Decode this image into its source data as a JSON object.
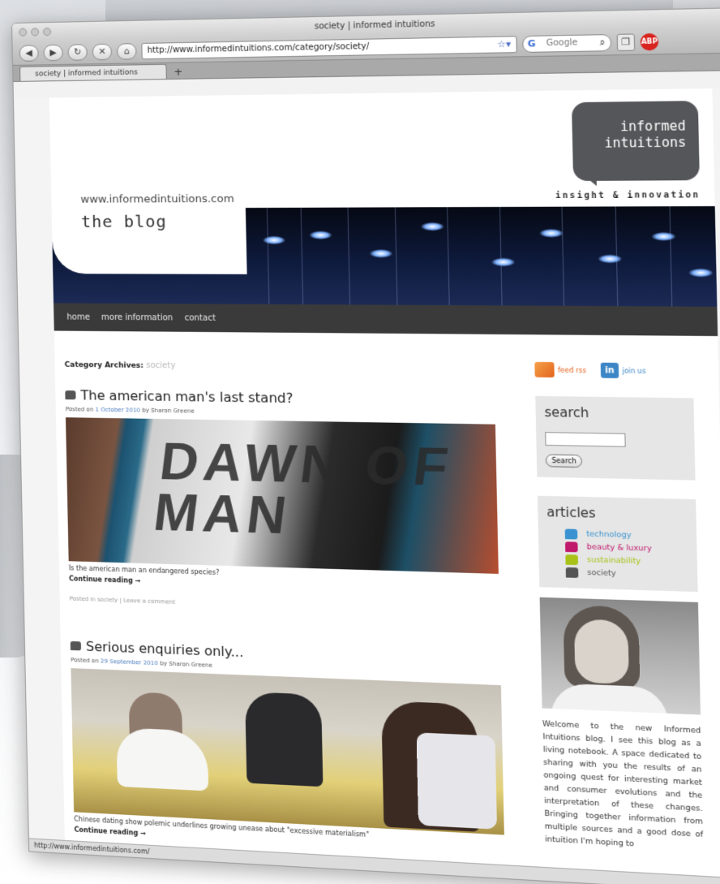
{
  "browser": {
    "window_title": "society | informed intuitions",
    "url": "http://www.informedintuitions.com/category/society/",
    "search_placeholder": "Google",
    "tab_title": "society | informed intuitions",
    "new_tab_symbol": "+",
    "status_url": "http://www.informedintuitions.com/"
  },
  "header": {
    "site_url": "www.informedintuitions.com",
    "blog_title": "the blog",
    "logo_line1": "informed",
    "logo_line2": "intuitions",
    "tagline": "insight & innovation"
  },
  "nav": {
    "items": [
      "home",
      "more information",
      "contact"
    ]
  },
  "content": {
    "category_label": "Category Archives:",
    "category_name": "society",
    "posts": [
      {
        "title": "The american man's last stand?",
        "posted_on": "Posted on",
        "date": "1 October 2010",
        "by": "by Sharon Greene",
        "image_text": "DAWN OF MAN",
        "excerpt": "Is the american man an endangered species?",
        "continue": "Continue reading →",
        "footer": "Posted in society | Leave a comment"
      },
      {
        "title": "Serious enquiries only...",
        "posted_on": "Posted on",
        "date": "29 September 2010",
        "by": "by Sharon Greene",
        "excerpt": "Chinese dating show polemic underlines growing unease about \"excessive materialism\"",
        "continue": "Continue reading →"
      }
    ]
  },
  "sidebar": {
    "feed_label": "feed rss",
    "join_label": "join us",
    "li_glyph": "in",
    "search_heading": "search",
    "search_button": "Search",
    "articles_heading": "articles",
    "articles": [
      {
        "label": "technology",
        "color": "#3a93d0"
      },
      {
        "label": "beauty & luxury",
        "color": "#c0186b"
      },
      {
        "label": "sustainability",
        "color": "#a8c21a"
      },
      {
        "label": "society",
        "color": "#555555"
      }
    ],
    "intro": "Welcome to the new Informed Intuitions blog. I see this blog as a living notebook. A space dedicated to sharing with you the results of an ongoing quest for interesting market and consumer evolutions and the interpretation of these changes. Bringing together information from multiple sources and a good dose of intuition I'm hoping to"
  },
  "icons": {
    "back": "back-icon",
    "forward": "forward-icon",
    "reload": "reload-icon",
    "stop": "stop-icon",
    "home": "home-icon",
    "rss": "rss-icon",
    "linkedin": "linkedin-icon",
    "adblock": "adblock-icon"
  },
  "colors": {
    "nav_bg": "#3a3a3a",
    "logo_bg": "#555659",
    "rss_orange": "#e2631c",
    "linkedin_blue": "#3c86c6"
  }
}
